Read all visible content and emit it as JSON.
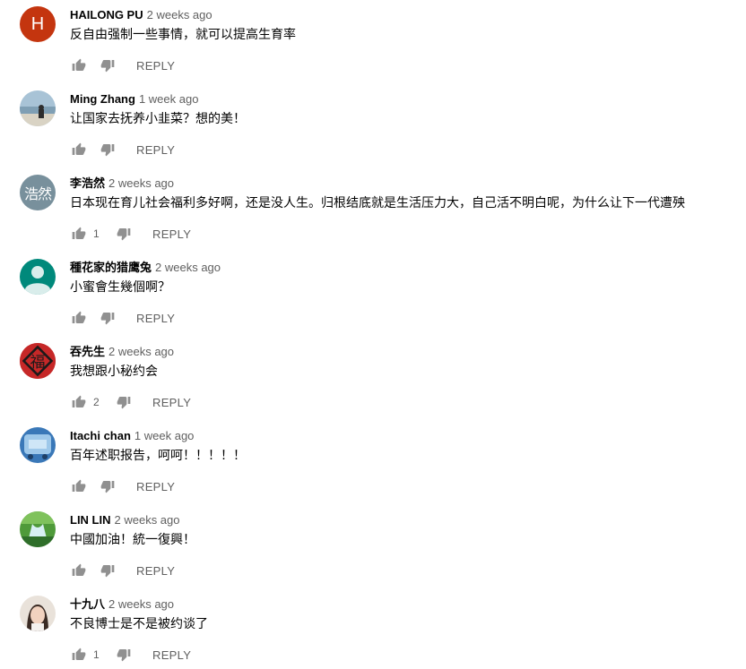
{
  "colors": {
    "text": "#030303",
    "secondary": "#606060",
    "icon": "#909090"
  },
  "comments": [
    {
      "author": "HAILONG PU",
      "time": "2 weeks ago",
      "text": "反自由强制一些事情，就可以提高生育率",
      "likes": "",
      "reply": "REPLY",
      "avatar": {
        "type": "letter",
        "letter": "H",
        "color": "#c4350f"
      }
    },
    {
      "author": "Ming Zhang",
      "time": "1 week ago",
      "text": "让国家去抚养小韭菜？想的美！",
      "likes": "",
      "reply": "REPLY",
      "avatar": {
        "type": "photo",
        "icon": "beach-photo"
      }
    },
    {
      "author": "李浩然",
      "time": "2 weeks ago",
      "text": "日本现在育儿社会福利多好啊，还是没人生。归根结底就是生活压力大，自己活不明白呢，为什么让下一代遭殃",
      "likes": "1",
      "reply": "REPLY",
      "avatar": {
        "type": "text",
        "letter": "浩然",
        "color": "#78909c"
      }
    },
    {
      "author": "種花家的猎鹰兔",
      "time": "2 weeks ago",
      "text": "小蜜會生幾個啊？",
      "likes": "",
      "reply": "REPLY",
      "avatar": {
        "type": "default",
        "color": "#00897b"
      }
    },
    {
      "author": "吞先生",
      "time": "2 weeks ago",
      "text": "我想跟小秘约会",
      "likes": "2",
      "reply": "REPLY",
      "avatar": {
        "type": "fu",
        "letter": "福",
        "color": "#c62828"
      }
    },
    {
      "author": "Itachi chan",
      "time": "1 week ago",
      "text": "百年述职报告，呵呵！！！！！",
      "likes": "",
      "reply": "REPLY",
      "avatar": {
        "type": "photo",
        "icon": "game-photo"
      }
    },
    {
      "author": "LIN LIN",
      "time": "2 weeks ago",
      "text": "中國加油！統一復興！",
      "likes": "",
      "reply": "REPLY",
      "avatar": {
        "type": "photo",
        "icon": "waterfall-photo"
      }
    },
    {
      "author": "十九八",
      "time": "2 weeks ago",
      "text": "不良博士是不是被约谈了",
      "likes": "1",
      "reply": "REPLY",
      "avatar": {
        "type": "photo",
        "icon": "girl-photo"
      }
    }
  ]
}
